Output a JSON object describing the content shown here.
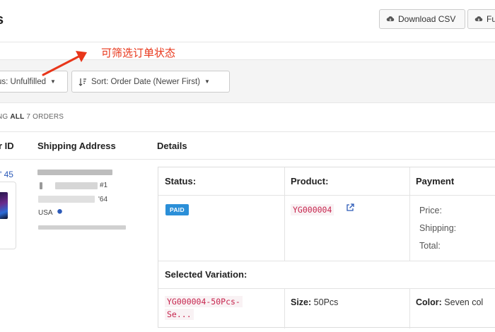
{
  "header": {
    "title": "s",
    "download_csv_label": "Download CSV",
    "second_button_label": "Fu"
  },
  "annotation": {
    "text": "可筛选订单状态",
    "color": "#e8361a"
  },
  "filters": {
    "status_label": "us: Unfulfilled",
    "sort_label": "Sort: Order Date (Newer First)"
  },
  "summary": {
    "prefix": "NG",
    "all_label": "ALL",
    "count": "7",
    "suffix": "ORDERS"
  },
  "table": {
    "headers": {
      "order_id": "r ID",
      "shipping_address": "Shipping Address",
      "details": "Details"
    }
  },
  "order": {
    "id_fragment": "' 45",
    "address": {
      "line_suffix": "#1",
      "zip_fragment": "'64",
      "country": "USA"
    },
    "details": {
      "status_label": "Status:",
      "product_label": "Product:",
      "payment_label": "Payment",
      "status_badge": "PAID",
      "product_code": "YG000004",
      "price_label": "Price:",
      "shipping_label": "Shipping:",
      "total_label": "Total:",
      "selected_variation_label": "Selected Variation:",
      "variation_code_line1": "YG000004-50Pcs-",
      "variation_code_line2": "Se...",
      "size_label": "Size:",
      "size_value": "50Pcs",
      "color_label": "Color:",
      "color_value": "Seven col"
    }
  },
  "colors": {
    "link": "#2c5ab8",
    "badge_paid": "#2b8fd8",
    "code_text": "#c7254e",
    "code_bg": "#f9f2f4"
  }
}
